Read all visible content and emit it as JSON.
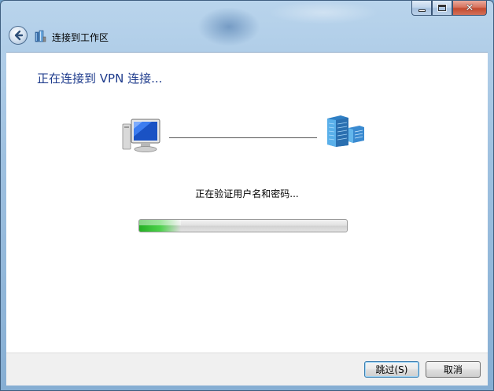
{
  "window": {
    "minimize_icon": "minimize-icon",
    "maximize_icon": "maximize-icon",
    "close_glyph": "✕"
  },
  "header": {
    "back_icon": "back-arrow-icon",
    "wizard_icon": "network-connection-icon",
    "title": "连接到工作区"
  },
  "main": {
    "heading": "正在连接到 VPN 连接...",
    "client_icon": "computer-icon",
    "server_icon": "server-icon",
    "status_text": "正在验证用户名和密码...",
    "progress": 0.2
  },
  "footer": {
    "skip_label": "跳过(S)",
    "cancel_label": "取消"
  }
}
